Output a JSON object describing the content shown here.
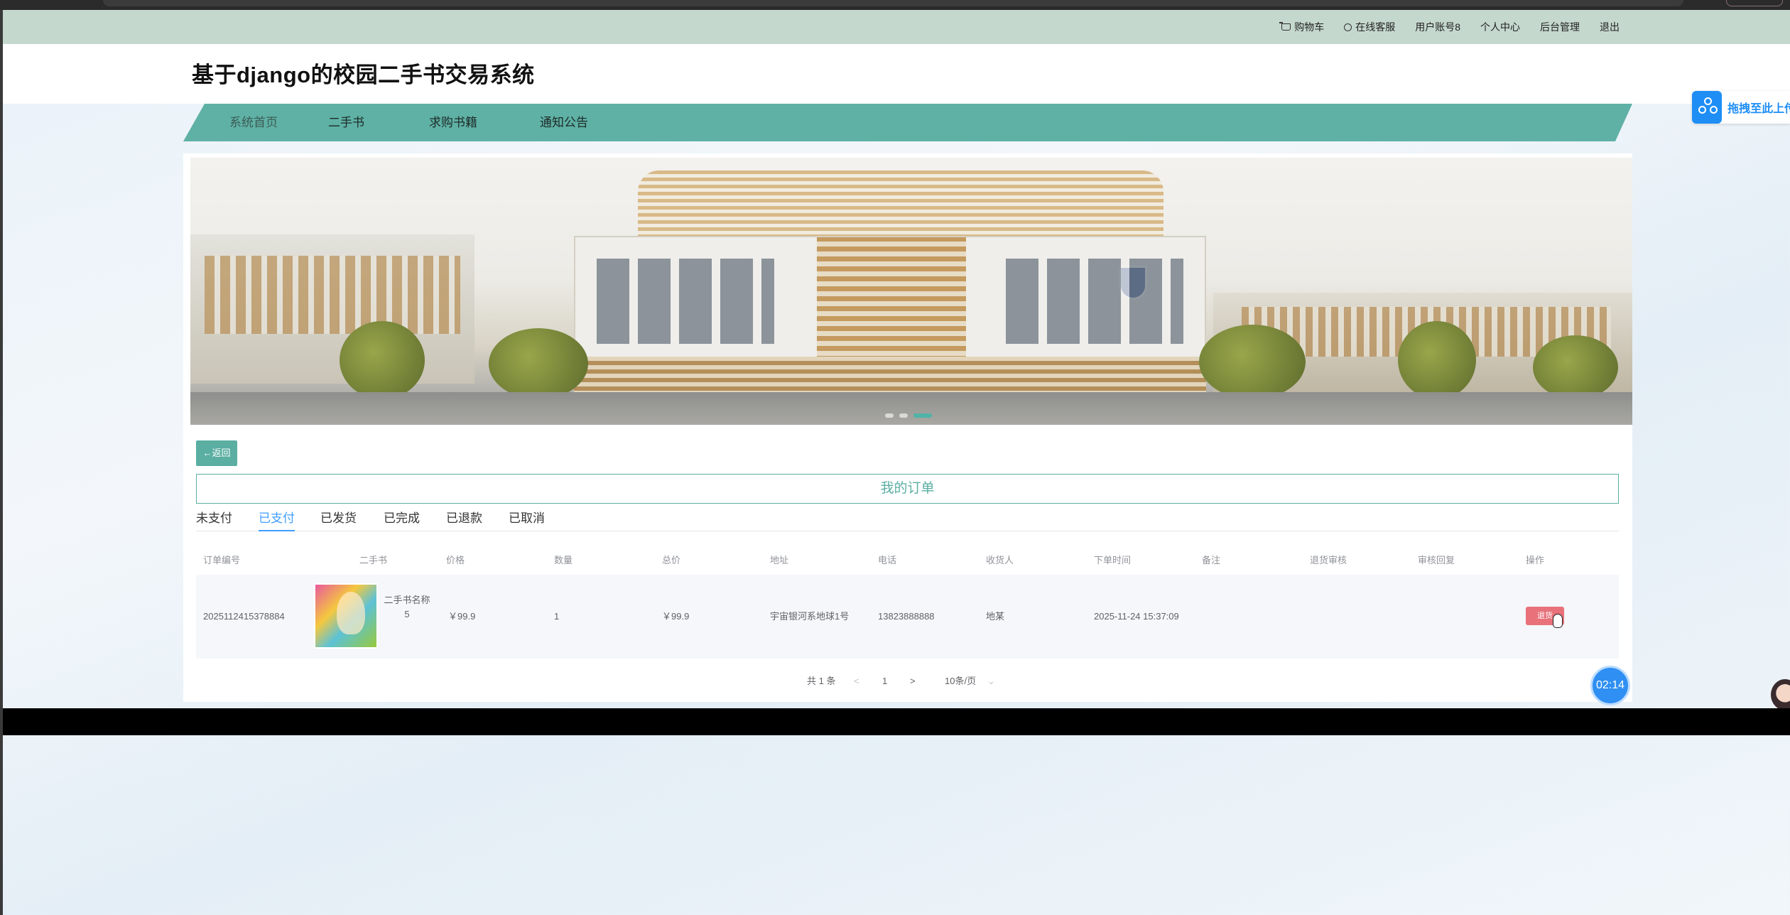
{
  "topbar": {
    "cart": "购物车",
    "service": "在线客服",
    "account": "用户账号8",
    "profile": "个人中心",
    "admin": "后台管理",
    "logout": "退出"
  },
  "header": {
    "title": "基于django的校园二手书交易系统"
  },
  "nav": [
    "系统首页",
    "二手书",
    "求购书籍",
    "通知公告"
  ],
  "float_tab": {
    "label": "拖拽至此上传"
  },
  "banner": {
    "icon": "campus-banner-image",
    "slide_count": 3,
    "active_slide": 2
  },
  "back_button": "←返回",
  "section_title": "我的订单",
  "tabs": {
    "items": [
      "未支付",
      "已支付",
      "已发货",
      "已完成",
      "已退款",
      "已取消"
    ],
    "active": "已支付"
  },
  "table": {
    "headers": [
      "订单编号",
      "二手书",
      "价格",
      "数量",
      "总价",
      "地址",
      "电话",
      "收货人",
      "下单时间",
      "备注",
      "退货审核",
      "审核回复",
      "操作"
    ],
    "rows": [
      {
        "order_no": "2025112415378884",
        "book_name_line1": "二手书名称",
        "book_name_line2": "5",
        "price": "￥99.9",
        "qty": "1",
        "total": "￥99.9",
        "address": "宇宙银河系地球1号",
        "phone": "13823888888",
        "receiver": "地某",
        "time": "2025-11-24 15:37:09",
        "remark": "",
        "return_review": "",
        "review_reply": "",
        "action": "退货"
      }
    ]
  },
  "pager": {
    "total": "共 1 条",
    "prev": "<",
    "page": "1",
    "next": ">",
    "size": "10条/页",
    "size_arrow": "⌄"
  },
  "timer": "02:14"
}
